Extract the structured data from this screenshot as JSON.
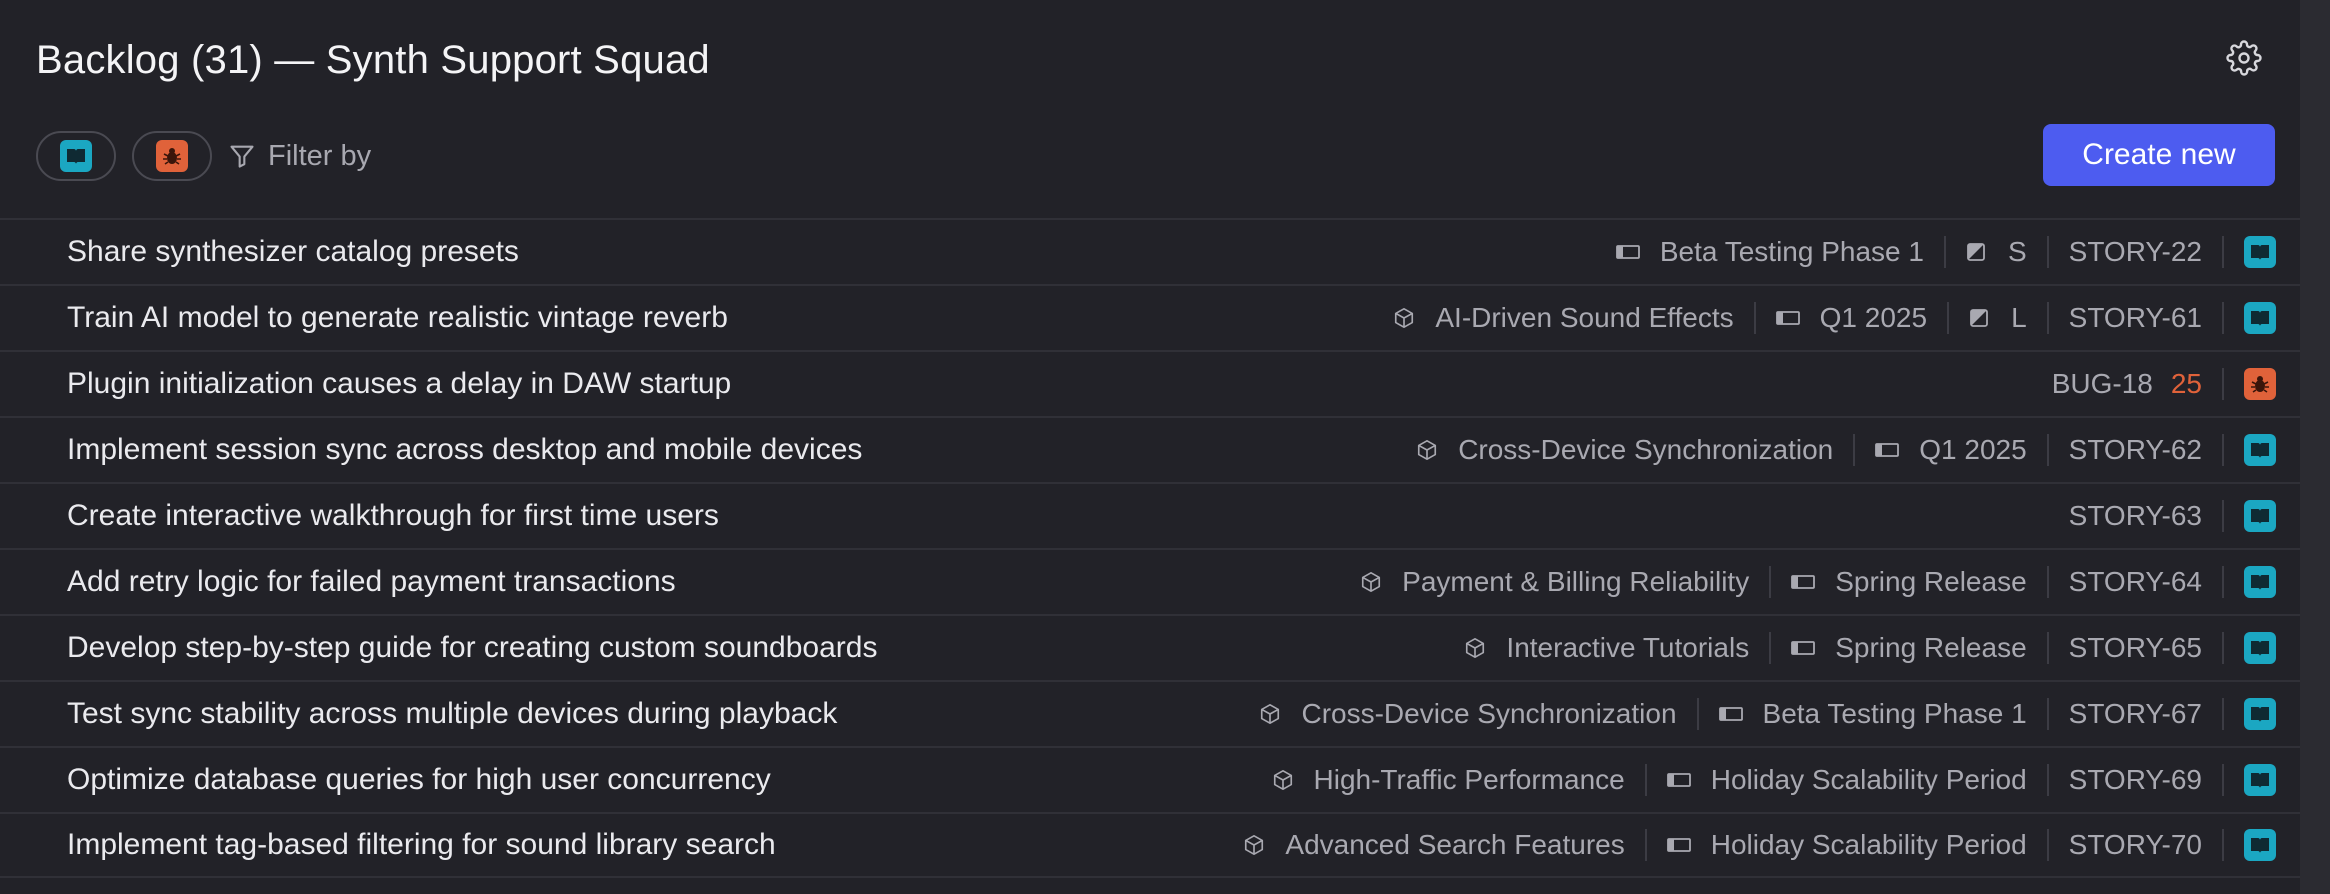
{
  "header": {
    "title": "Backlog (31) — Synth Support Squad"
  },
  "toolbar": {
    "filter_label": "Filter by",
    "create_label": "Create new",
    "chips": [
      {
        "type": "story",
        "icon": "book-icon"
      },
      {
        "type": "bug",
        "icon": "bug-icon"
      }
    ]
  },
  "colors": {
    "accent": "#4d5cf0",
    "story": "#1ba7c2",
    "bug": "#e0623a",
    "background": "#222228"
  },
  "rows": [
    {
      "title": "Share synthesizer catalog presets",
      "epic": "",
      "sprint": "Beta Testing Phase 1",
      "size": "S",
      "key": "STORY-22",
      "points": "",
      "type": "story"
    },
    {
      "title": "Train AI model to generate realistic vintage reverb",
      "epic": "AI-Driven Sound Effects",
      "sprint": "Q1 2025",
      "size": "L",
      "key": "STORY-61",
      "points": "",
      "type": "story"
    },
    {
      "title": "Plugin initialization causes a delay in DAW startup",
      "epic": "",
      "sprint": "",
      "size": "",
      "key": "BUG-18",
      "points": "25",
      "type": "bug"
    },
    {
      "title": "Implement session sync across desktop and mobile devices",
      "epic": "Cross-Device Synchronization",
      "sprint": "Q1 2025",
      "size": "",
      "key": "STORY-62",
      "points": "",
      "type": "story"
    },
    {
      "title": "Create interactive walkthrough for first time users",
      "epic": "",
      "sprint": "",
      "size": "",
      "key": "STORY-63",
      "points": "",
      "type": "story"
    },
    {
      "title": "Add retry logic for failed payment transactions",
      "epic": "Payment & Billing Reliability",
      "sprint": "Spring Release",
      "size": "",
      "key": "STORY-64",
      "points": "",
      "type": "story"
    },
    {
      "title": "Develop step-by-step guide for creating custom soundboards",
      "epic": "Interactive Tutorials",
      "sprint": "Spring Release",
      "size": "",
      "key": "STORY-65",
      "points": "",
      "type": "story"
    },
    {
      "title": "Test sync stability across multiple devices during playback",
      "epic": "Cross-Device Synchronization",
      "sprint": "Beta Testing Phase 1",
      "size": "",
      "key": "STORY-67",
      "points": "",
      "type": "story"
    },
    {
      "title": "Optimize database queries for high user concurrency",
      "epic": "High-Traffic Performance",
      "sprint": "Holiday Scalability Period",
      "size": "",
      "key": "STORY-69",
      "points": "",
      "type": "story"
    },
    {
      "title": "Implement tag-based filtering for sound library search",
      "epic": "Advanced Search Features",
      "sprint": "Holiday Scalability Period",
      "size": "",
      "key": "STORY-70",
      "points": "",
      "type": "story"
    }
  ]
}
